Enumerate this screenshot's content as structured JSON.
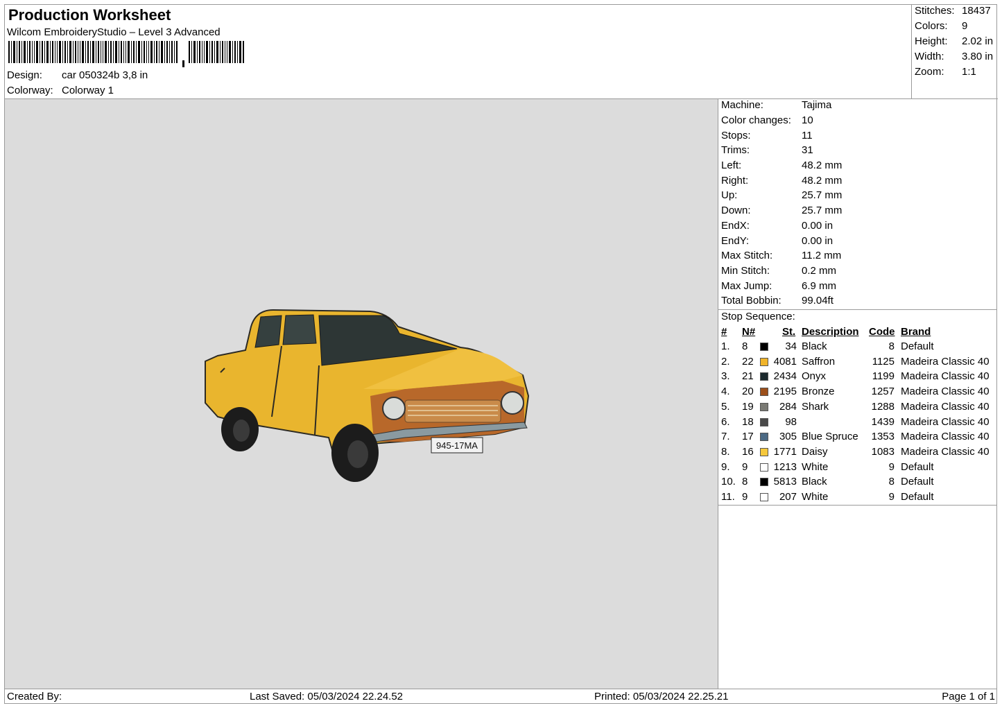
{
  "header": {
    "title": "Production Worksheet",
    "software": "Wilcom EmbroideryStudio – Level 3 Advanced",
    "design_label": "Design:",
    "design_value": "car 050324b 3,8 in",
    "colorway_label": "Colorway:",
    "colorway_value": "Colorway 1"
  },
  "summary": [
    {
      "label": "Stitches:",
      "value": "18437"
    },
    {
      "label": "Colors:",
      "value": "9"
    },
    {
      "label": "Height:",
      "value": "2.02 in"
    },
    {
      "label": "Width:",
      "value": "3.80 in"
    },
    {
      "label": "Zoom:",
      "value": "1:1"
    }
  ],
  "machine_info": [
    {
      "label": "Machine:",
      "value": "Tajima"
    },
    {
      "label": "Color changes:",
      "value": "10"
    },
    {
      "label": "Stops:",
      "value": "11"
    },
    {
      "label": "Trims:",
      "value": "31"
    },
    {
      "label": "Left:",
      "value": "48.2 mm"
    },
    {
      "label": "Right:",
      "value": "48.2 mm"
    },
    {
      "label": "Up:",
      "value": "25.7 mm"
    },
    {
      "label": "Down:",
      "value": "25.7 mm"
    },
    {
      "label": "EndX:",
      "value": "0.00 in"
    },
    {
      "label": "EndY:",
      "value": "0.00 in"
    },
    {
      "label": "Max Stitch:",
      "value": "11.2 mm"
    },
    {
      "label": "Min Stitch:",
      "value": "0.2 mm"
    },
    {
      "label": "Max Jump:",
      "value": "6.9 mm"
    },
    {
      "label": "Total Bobbin:",
      "value": "99.04ft"
    }
  ],
  "stop_sequence": {
    "title": "Stop Sequence:",
    "headers": {
      "num": "#",
      "n": "N#",
      "st": "St.",
      "desc": "Description",
      "code": "Code",
      "brand": "Brand"
    },
    "rows": [
      {
        "num": "1.",
        "n": "8",
        "color": "#000000",
        "st": "34",
        "desc": "Black",
        "code": "8",
        "brand": "Default"
      },
      {
        "num": "2.",
        "n": "22",
        "color": "#f0b42a",
        "st": "4081",
        "desc": "Saffron",
        "code": "1125",
        "brand": "Madeira Classic 40"
      },
      {
        "num": "3.",
        "n": "21",
        "color": "#1c2a2e",
        "st": "2434",
        "desc": "Onyx",
        "code": "1199",
        "brand": "Madeira Classic 40"
      },
      {
        "num": "4.",
        "n": "20",
        "color": "#9c4f1a",
        "st": "2195",
        "desc": "Bronze",
        "code": "1257",
        "brand": "Madeira Classic 40"
      },
      {
        "num": "5.",
        "n": "19",
        "color": "#7a7a74",
        "st": "284",
        "desc": "Shark",
        "code": "1288",
        "brand": "Madeira Classic 40"
      },
      {
        "num": "6.",
        "n": "18",
        "color": "#4a4a4a",
        "st": "98",
        "desc": "",
        "code": "1439",
        "brand": "Madeira Classic 40"
      },
      {
        "num": "7.",
        "n": "17",
        "color": "#4c6a84",
        "st": "305",
        "desc": "Blue Spruce",
        "code": "1353",
        "brand": "Madeira Classic 40"
      },
      {
        "num": "8.",
        "n": "16",
        "color": "#f6c83c",
        "st": "1771",
        "desc": "Daisy",
        "code": "1083",
        "brand": "Madeira Classic 40"
      },
      {
        "num": "9.",
        "n": "9",
        "color": "#ffffff",
        "st": "1213",
        "desc": "White",
        "code": "9",
        "brand": "Default"
      },
      {
        "num": "10.",
        "n": "8",
        "color": "#000000",
        "st": "5813",
        "desc": "Black",
        "code": "8",
        "brand": "Default"
      },
      {
        "num": "11.",
        "n": "9",
        "color": "#ffffff",
        "st": "207",
        "desc": "White",
        "code": "9",
        "brand": "Default"
      }
    ]
  },
  "preview": {
    "plate_text": "945-17MA"
  },
  "footer": {
    "created_by": "Created By:",
    "last_saved": "Last Saved: 05/03/2024 22.24.52",
    "printed": "Printed: 05/03/2024 22.25.21",
    "page": "Page 1 of 1"
  }
}
